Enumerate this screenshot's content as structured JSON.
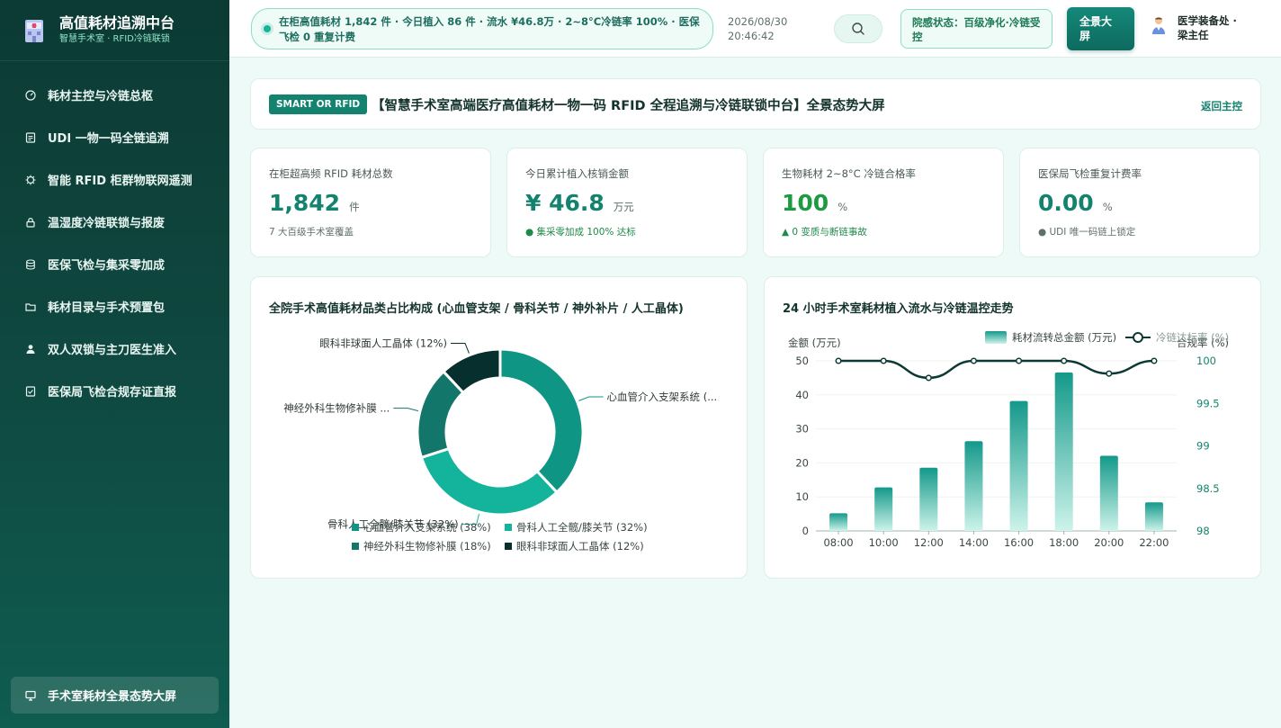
{
  "sidebar": {
    "brand_title": "高值耗材追溯中台",
    "brand_sub": "智慧手术室 · RFID冷链联锁",
    "items": [
      {
        "label": "耗材主控与冷链总枢",
        "icon": "gauge-icon"
      },
      {
        "label": "UDI 一物一码全链追溯",
        "icon": "document-icon"
      },
      {
        "label": "智能 RFID 柜群物联网遥测",
        "icon": "chip-icon"
      },
      {
        "label": "温湿度冷链联锁与报废",
        "icon": "lock-icon"
      },
      {
        "label": "医保飞检与集采零加成",
        "icon": "database-icon"
      },
      {
        "label": "耗材目录与手术预置包",
        "icon": "folder-icon"
      },
      {
        "label": "双人双锁与主刀医生准入",
        "icon": "user-icon"
      },
      {
        "label": "医保局飞检合规存证直报",
        "icon": "file-check-icon"
      }
    ],
    "bottom_item": {
      "label": "手术室耗材全景态势大屏",
      "icon": "monitor-icon"
    }
  },
  "header": {
    "ticker": "在柜高值耗材 1,842 件 · 今日植入 86 件 · 流水 ¥46.8万 · 2~8°C冷链率 100% · 医保飞检 0 重复计费",
    "date": "2026/08/30",
    "time": "20:46:42",
    "status": "院感状态：百级净化·冷链受控",
    "fullscreen_label": "全景大屏",
    "user": "医学装备处 · 梁主任"
  },
  "titlebar": {
    "tag": "SMART OR RFID",
    "title": "【智慧手术室高端医疗高值耗材一物一码 RFID 全程追溯与冷链联锁中台】全景态势大屏",
    "back": "返回主控"
  },
  "kpis": [
    {
      "label": "在柜超高频 RFID 耗材总数",
      "value": "1,842",
      "unit": "件",
      "note": "7 大百级手术室覆盖"
    },
    {
      "label": "今日累计植入核销金额",
      "value": "¥ 46.8",
      "unit": "万元",
      "note": "● 集采零加成 100% 达标"
    },
    {
      "label": "生物耗材 2~8°C 冷链合格率",
      "value": "100",
      "unit": "%",
      "note": "▲ 0 变质与断链事故"
    },
    {
      "label": "医保局飞检重复计费率",
      "value": "0.00",
      "unit": "%",
      "note": "● UDI 唯一码链上锁定"
    }
  ],
  "colors": {
    "accent": "#13836f",
    "teal": "#14b39c",
    "dark": "#062f2d",
    "green": "#1e9a42"
  },
  "chart_data": [
    {
      "type": "pie",
      "title": "全院手术高值耗材品类占比构成 (心血管支架 / 骨科关节 / 神外补片 / 人工晶体)",
      "slice_labels": [
        "心血管介入支架系统 (...",
        "骨科人工全髋/膝关节 (32%)",
        "神经外科生物修补膜 ...",
        "眼科非球面人工晶体 (12%)"
      ],
      "legend": [
        "心血管介入支架系统 (38%)",
        "骨科人工全髋/膝关节 (32%)",
        "神经外科生物修补膜 (18%)",
        "眼科非球面人工晶体 (12%)"
      ],
      "values": [
        38,
        32,
        18,
        12
      ],
      "colors": [
        "#0f9584",
        "#14b39c",
        "#12766b",
        "#062f2d"
      ]
    },
    {
      "type": "bar",
      "title": "24 小时手术室耗材植入流水与冷链温控走势",
      "categories": [
        "08:00",
        "10:00",
        "12:00",
        "14:00",
        "16:00",
        "18:00",
        "20:00",
        "22:00"
      ],
      "ylabel": "金额 (万元)",
      "y2label": "合规率 (%)",
      "ylim": [
        0,
        50
      ],
      "y2lim": [
        98,
        100
      ],
      "yticks": [
        "0",
        "10",
        "20",
        "30",
        "40",
        "50"
      ],
      "y2ticks": [
        "98",
        "98.5",
        "99",
        "99.5",
        "100"
      ],
      "series": [
        {
          "name": "耗材流转总金额 (万元)",
          "type": "bar",
          "values": [
            5.2,
            12.8,
            18.6,
            26.4,
            38.2,
            46.6,
            22.1,
            8.4
          ]
        },
        {
          "name": "冷链达标率 (%)",
          "type": "line",
          "axis": "right",
          "values": [
            100,
            100,
            99.8,
            100,
            100,
            100,
            99.85,
            100
          ]
        }
      ]
    }
  ]
}
